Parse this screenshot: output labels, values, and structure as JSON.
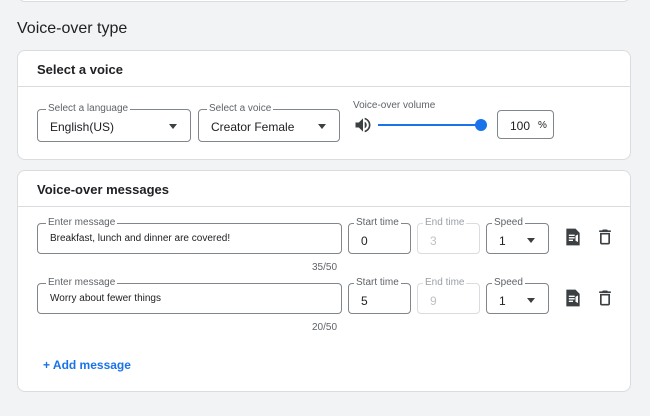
{
  "section_title": "Voice-over type",
  "select_voice": {
    "header": "Select a voice",
    "language": {
      "label": "Select a language",
      "value": "English(US)"
    },
    "voice": {
      "label": "Select a voice",
      "value": "Creator Female"
    },
    "volume": {
      "label": "Voice-over volume",
      "value": "100",
      "unit": "%",
      "level": 1.0
    }
  },
  "messages": {
    "header": "Voice-over messages",
    "items": [
      {
        "message_label": "Enter message",
        "message": "Breakfast, lunch and dinner are covered!",
        "counter": "35/50",
        "start_label": "Start time",
        "start": "0",
        "end_label": "End time",
        "end": "3",
        "speed_label": "Speed",
        "speed": "1"
      },
      {
        "message_label": "Enter message",
        "message": "Worry about fewer things",
        "counter": "20/50",
        "start_label": "Start time",
        "start": "5",
        "end_label": "End time",
        "end": "9",
        "speed_label": "Speed",
        "speed": "1"
      }
    ],
    "add_label": "+ Add message"
  },
  "icons": {
    "volume": "volume-icon",
    "preview": "voice-preview-icon",
    "delete": "delete-icon",
    "dropdown": "chevron-down-icon"
  },
  "colors": {
    "accent": "#1a73e8",
    "border": "#dadce0",
    "text": "#202124"
  }
}
